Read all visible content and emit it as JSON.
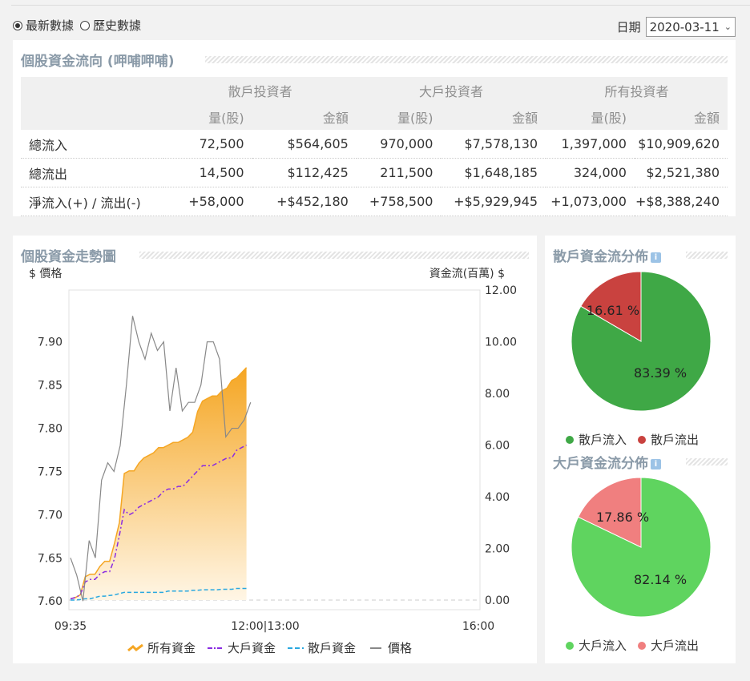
{
  "radios": [
    {
      "label": "最新數據",
      "checked": true
    },
    {
      "label": "歷史數據",
      "checked": false
    }
  ],
  "date": {
    "label": "日期",
    "value": "2020-03-11"
  },
  "flow_table": {
    "title": "個股資金流向 (呷哺呷哺)",
    "groups": [
      "散戶投資者",
      "大戶投資者",
      "所有投資者"
    ],
    "subheaders": [
      "量(股)",
      "金額",
      "量(股)",
      "金額",
      "量(股)",
      "金額"
    ],
    "rows": [
      {
        "label": "總流入",
        "cells": [
          "72,500",
          "$564,605",
          "970,000",
          "$7,578,130",
          "1,397,000",
          "$10,909,620"
        ]
      },
      {
        "label": "總流出",
        "cells": [
          "14,500",
          "$112,425",
          "211,500",
          "$1,648,185",
          "324,000",
          "$2,521,380"
        ]
      },
      {
        "label": "淨流入(+) / 流出(-)",
        "cells": [
          "+58,000",
          "+$452,180",
          "+758,500",
          "+$5,929,945",
          "+1,073,000",
          "+$8,388,240"
        ]
      }
    ]
  },
  "trend": {
    "title": "個股資金走勢圖",
    "left_label": "$ 價格",
    "right_label": "資金流(百萬) $"
  },
  "chart_data": [
    {
      "type": "line",
      "title": "個股資金走勢圖",
      "x_ticks": [
        "09:35",
        "12:00|13:00",
        "16:00"
      ],
      "y_left_label": "$ 價格",
      "y_left_ticks": [
        "7.60",
        "7.65",
        "7.70",
        "7.75",
        "7.80",
        "7.85",
        "7.90"
      ],
      "y_left_range": [
        7.59,
        7.96
      ],
      "y_right_label": "資金流(百萬) $",
      "y_right_ticks": [
        "0.00",
        "2.00",
        "4.00",
        "6.00",
        "8.00",
        "10.00",
        "12.00"
      ],
      "y_right_range": [
        0,
        12
      ],
      "legend_position": "bottom",
      "grid": false,
      "series": [
        {
          "name": "所有資金",
          "axis": "right",
          "style": "area",
          "color": "#f5a623",
          "values": [
            0.05,
            0.1,
            0.2,
            0.9,
            1.0,
            1.0,
            1.3,
            1.5,
            1.5,
            2.2,
            3.0,
            4.9,
            5.0,
            5.0,
            5.3,
            5.5,
            5.6,
            5.7,
            5.9,
            5.9,
            6.0,
            6.1,
            6.1,
            6.2,
            6.3,
            6.5,
            7.3,
            7.7,
            7.8,
            7.9,
            7.9,
            8.1,
            8.2,
            8.5,
            8.6,
            8.8,
            9.0
          ]
        },
        {
          "name": "大戶資金",
          "axis": "right",
          "style": "dashdot",
          "color": "#8a2be2",
          "values": [
            0.05,
            0.1,
            0.2,
            0.7,
            0.8,
            0.8,
            1.0,
            1.1,
            1.1,
            1.6,
            2.5,
            3.5,
            3.3,
            3.4,
            3.6,
            3.7,
            3.8,
            3.9,
            4.0,
            4.2,
            4.3,
            4.3,
            4.4,
            4.4,
            4.6,
            4.8,
            5.0,
            5.2,
            5.2,
            5.2,
            5.3,
            5.4,
            5.5,
            5.5,
            5.8,
            5.9,
            6.0
          ]
        },
        {
          "name": "散戶資金",
          "axis": "right",
          "style": "dashed",
          "color": "#29a8e0",
          "values": [
            0.0,
            0.0,
            0.02,
            0.05,
            0.05,
            0.1,
            0.15,
            0.15,
            0.18,
            0.2,
            0.25,
            0.3,
            0.3,
            0.3,
            0.3,
            0.3,
            0.3,
            0.3,
            0.3,
            0.3,
            0.35,
            0.35,
            0.35,
            0.35,
            0.35,
            0.38,
            0.38,
            0.4,
            0.4,
            0.4,
            0.4,
            0.42,
            0.42,
            0.42,
            0.45,
            0.45,
            0.45
          ]
        },
        {
          "name": "價格",
          "axis": "left",
          "style": "solid",
          "color": "#888888",
          "values": [
            7.65,
            7.63,
            7.6,
            7.67,
            7.65,
            7.74,
            7.76,
            7.75,
            7.78,
            7.85,
            7.93,
            7.9,
            7.88,
            7.91,
            7.89,
            7.9,
            7.82,
            7.87,
            7.82,
            7.83,
            7.83,
            7.85,
            7.9,
            7.9,
            7.88,
            7.79,
            7.8,
            7.8,
            7.81,
            7.83
          ]
        }
      ]
    },
    {
      "type": "pie",
      "title": "散戶資金流分佈",
      "labels": [
        "散戶流入",
        "散戶流出"
      ],
      "values": [
        83.39,
        16.61
      ],
      "value_labels": [
        "83.39 %",
        "16.61 %"
      ],
      "colors": [
        "#3fa846",
        "#c9423f"
      ],
      "legend_position": "bottom"
    },
    {
      "type": "pie",
      "title": "大戶資金流分佈",
      "labels": [
        "大戶流入",
        "大戶流出"
      ],
      "values": [
        82.14,
        17.86
      ],
      "value_labels": [
        "82.14 %",
        "17.86 %"
      ],
      "colors": [
        "#5fd45f",
        "#f07f7f"
      ],
      "legend_position": "bottom"
    }
  ]
}
